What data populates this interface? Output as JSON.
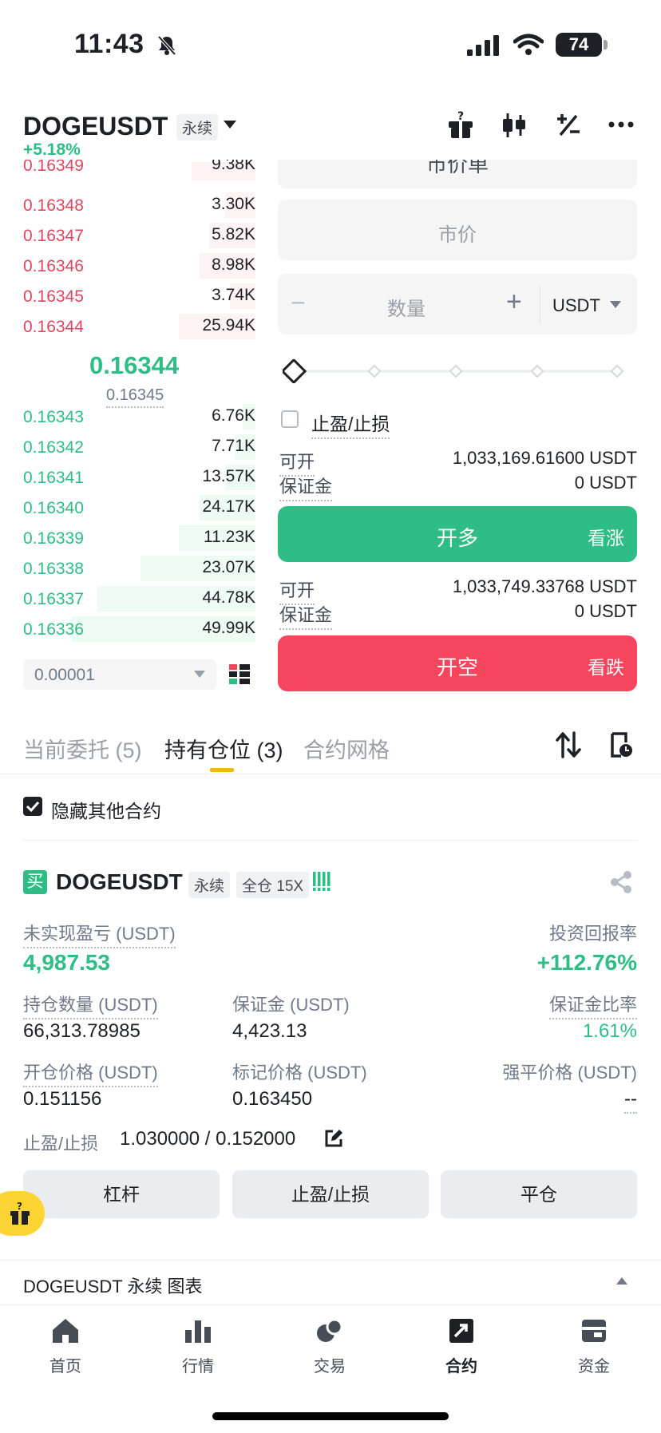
{
  "status_bar": {
    "time": "11:43",
    "battery": "74"
  },
  "header": {
    "symbol": "DOGEUSDT",
    "contract_type": "永续",
    "change": "+5.18%"
  },
  "order_book": {
    "asks": [
      {
        "price": "0.16349",
        "qty": "9.38K",
        "depth": 0.25
      },
      {
        "price": "0.16348",
        "qty": "3.30K",
        "depth": 0.12
      },
      {
        "price": "0.16347",
        "qty": "5.82K",
        "depth": 0.18
      },
      {
        "price": "0.16346",
        "qty": "8.98K",
        "depth": 0.22
      },
      {
        "price": "0.16345",
        "qty": "3.74K",
        "depth": 0.1
      },
      {
        "price": "0.16344",
        "qty": "25.94K",
        "depth": 0.3
      }
    ],
    "mid_price": "0.16344",
    "mark_price": "0.16345",
    "bids": [
      {
        "price": "0.16343",
        "qty": "6.76K",
        "depth": 0.05
      },
      {
        "price": "0.16342",
        "qty": "7.71K",
        "depth": 0.08
      },
      {
        "price": "0.16341",
        "qty": "13.57K",
        "depth": 0.12
      },
      {
        "price": "0.16340",
        "qty": "24.17K",
        "depth": 0.22
      },
      {
        "price": "0.16339",
        "qty": "11.23K",
        "depth": 0.3
      },
      {
        "price": "0.16338",
        "qty": "23.07K",
        "depth": 0.45
      },
      {
        "price": "0.16337",
        "qty": "44.78K",
        "depth": 0.62
      },
      {
        "price": "0.16336",
        "qty": "49.99K",
        "depth": 0.72
      }
    ],
    "tick_size": "0.00001"
  },
  "order_form": {
    "order_type": "市价单",
    "price_placeholder": "市价",
    "qty_placeholder": "数量",
    "minus": "−",
    "plus": "+",
    "unit": "USDT",
    "tpsl_label": "止盈/止损",
    "long": {
      "avail_label": "可开",
      "avail_value": "1,033,169.61600 USDT",
      "margin_label": "保证金",
      "margin_value": "0 USDT",
      "button": "开多",
      "button_sub": "看涨"
    },
    "short": {
      "avail_label": "可开",
      "avail_value": "1,033,749.33768 USDT",
      "margin_label": "保证金",
      "margin_value": "0 USDT",
      "button": "开空",
      "button_sub": "看跌"
    }
  },
  "tabs": [
    "当前委托 (5)",
    "持有仓位 (3)",
    "合约网格"
  ],
  "hide_other": "隐藏其他合约",
  "position": {
    "side_badge": "买",
    "symbol": "DOGEUSDT",
    "contract_type": "永续",
    "margin_mode": "全仓 15X",
    "upnl_label": "未实现盈亏 (USDT)",
    "upnl_value": "4,987.53",
    "roe_label": "投资回报率",
    "roe_value": "+112.76%",
    "size_label": "持仓数量 (USDT)",
    "size_value": "66,313.78985",
    "margin_label": "保证金 (USDT)",
    "margin_value": "4,423.13",
    "margin_ratio_label": "保证金比率",
    "margin_ratio_value": "1.61%",
    "entry_label": "开仓价格 (USDT)",
    "entry_value": "0.151156",
    "mark_label": "标记价格 (USDT)",
    "mark_value": "0.163450",
    "liq_label": "强平价格 (USDT)",
    "liq_value": "--",
    "tpsl_label": "止盈/止损",
    "tpsl_value": "1.030000 / 0.152000",
    "buttons": [
      "杠杆",
      "止盈/止损",
      "平仓"
    ]
  },
  "chart_bar": {
    "label": "DOGEUSDT 永续  图表"
  },
  "bottom_nav": [
    "首页",
    "行情",
    "交易",
    "合约",
    "资金"
  ],
  "colors": {
    "green": "#2ebd85",
    "red": "#f6465d",
    "accent": "#f0b90b"
  }
}
